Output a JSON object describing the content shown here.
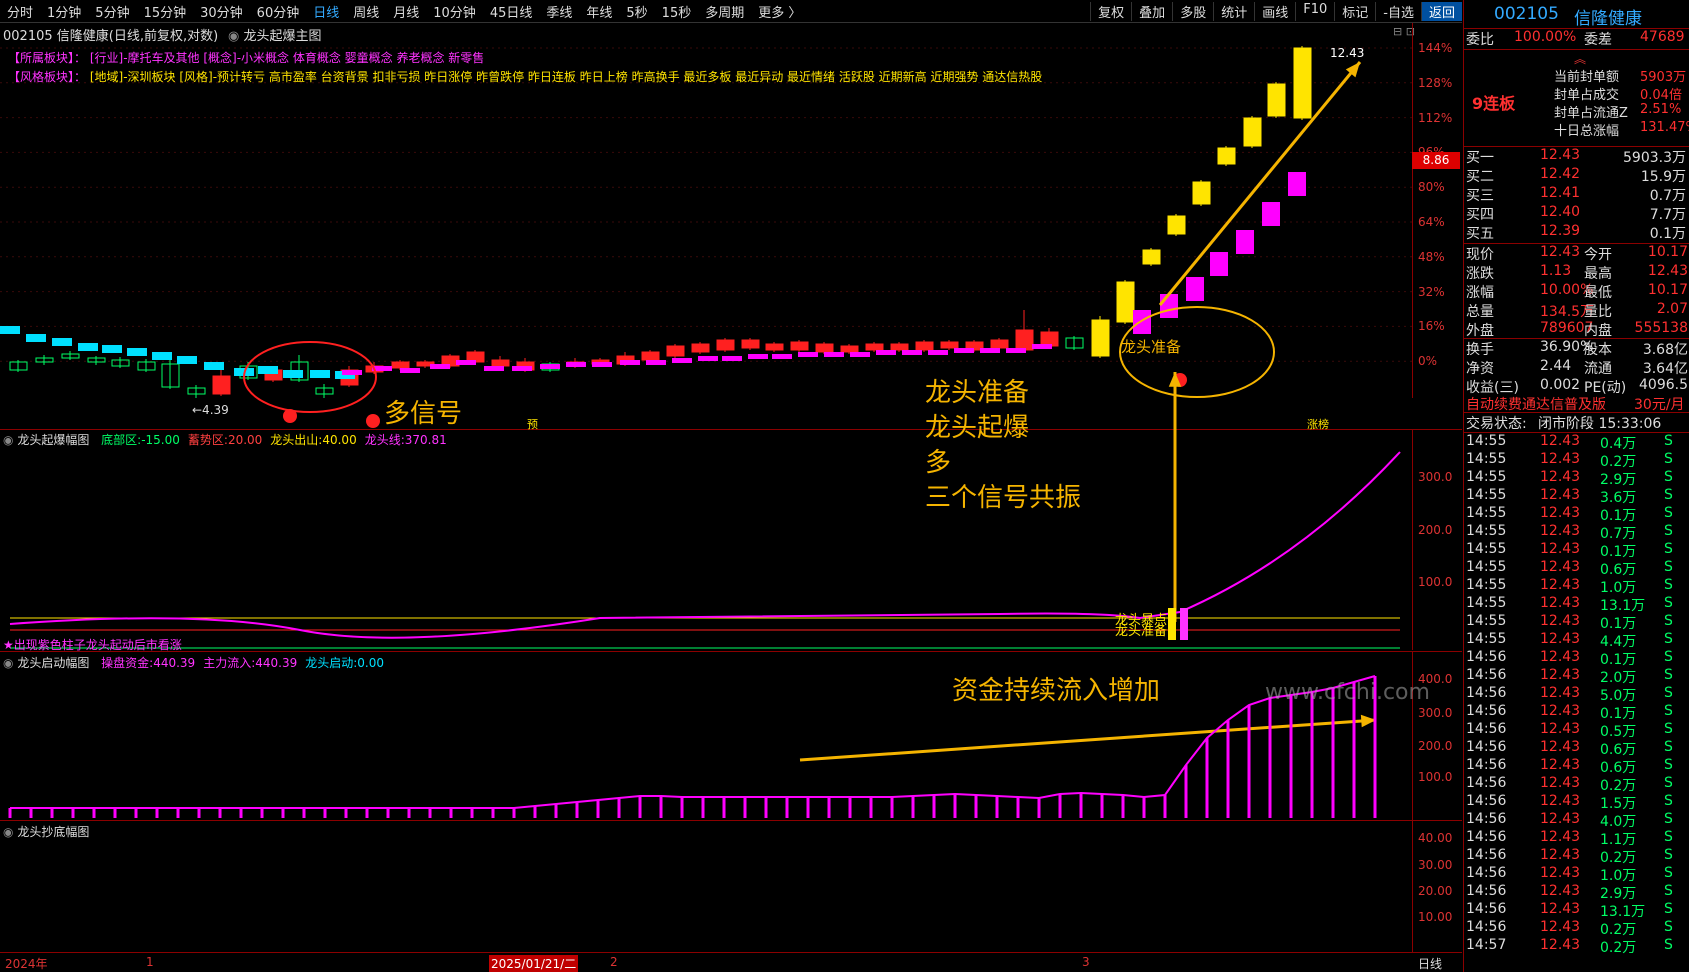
{
  "colors": {
    "up": "#ff2020",
    "down": "#00ff66",
    "magenta": "#ff00ff",
    "yellow": "#ffe400",
    "cyan": "#00e0ff",
    "accent": "#f5b400"
  },
  "toolbar": {
    "left": [
      "分时",
      "1分钟",
      "5分钟",
      "15分钟",
      "30分钟",
      "60分钟",
      "日线",
      "周线",
      "月线",
      "10分钟",
      "45日线",
      "季线",
      "年线",
      "5秒",
      "15秒",
      "多周期",
      "更多 〉"
    ],
    "active": "日线",
    "right": [
      "复权",
      "叠加",
      "多股",
      "统计",
      "画线",
      "F10",
      "标记",
      "-自选",
      "返回"
    ]
  },
  "chart": {
    "title": "002105 信隆健康(日线,前复权,对数)",
    "subtitle": "龙头起爆主图",
    "sector_label": "【所属板块】：",
    "sector_text": "[行业]-摩托车及其他 [概念]-小米概念 体育概念 婴童概念 养老概念 新零售",
    "style_label": "【风格板块】：",
    "style_text": "[地域]-深圳板块 [风格]-预计转亏 高市盈率 台资背景 扣非亏损 昨日涨停 昨曾跌停 昨日连板 昨日上榜 昨高换手 最近多板 最近异动 最近情绪 活跃股 近期新高 近期强势 通达信热股",
    "yaxis": [
      "144%",
      "128%",
      "112%",
      "96%",
      "80%",
      "64%",
      "48%",
      "32%",
      "16%",
      "0%"
    ],
    "price_tag": "8.86",
    "high_label": "12.43",
    "low_label": "←4.39",
    "marker_yu": "预",
    "marker_zb": "涨榜",
    "signal_circle_text": "龙头准备",
    "duo": "多"
  },
  "annotations": {
    "duo_signal": "多信号",
    "lines": [
      "龙头准备",
      "龙头起爆",
      "多",
      "三个信号共振"
    ],
    "fund": "资金持续流入增加",
    "watermark": "www.cfchi.com"
  },
  "panel1": {
    "title": "龙头起爆幅图",
    "items": [
      {
        "label": "底部区:",
        "value": "-15.00"
      },
      {
        "label": "蓄势区:",
        "value": "20.00"
      },
      {
        "label": "龙头出山:",
        "value": "40.00"
      },
      {
        "label": "龙头线:",
        "value": "370.81"
      }
    ],
    "yaxis": [
      "300.0",
      "200.0",
      "100.0"
    ],
    "note": "★出现紫色柱子龙头起动后市看涨",
    "tag1": "龙头暴点",
    "tag2": "龙头准备"
  },
  "panel2": {
    "title": "龙头启动幅图",
    "items": [
      {
        "label": "操盘资金:",
        "value": "440.39"
      },
      {
        "label": "主力流入:",
        "value": "440.39"
      },
      {
        "label": "龙头启动:",
        "value": "0.00"
      }
    ],
    "yaxis": [
      "400.0",
      "300.0",
      "200.0",
      "100.0"
    ]
  },
  "panel3": {
    "title": "龙头抄底幅图",
    "yaxis": [
      "40.00",
      "30.00",
      "20.00",
      "10.00"
    ]
  },
  "timeaxis": {
    "labels": [
      "2024年",
      "1",
      "2025/01/21/二",
      "2",
      "3"
    ],
    "period": "日线"
  },
  "quote": {
    "code": "002105",
    "name": "信隆健康",
    "weibi_label": "委比",
    "weibi": "100.00%",
    "weicha_label": "委差",
    "weicha": "47689",
    "board": "9连板",
    "seal_items": [
      {
        "label": "当前封单额",
        "value": "5903万"
      },
      {
        "label": "封单占成交",
        "value": "0.04倍"
      },
      {
        "label": "封单占流通Z",
        "value": "2.51%"
      },
      {
        "label": "十日总涨幅",
        "value": "131.47%"
      }
    ],
    "bids": [
      {
        "label": "买一",
        "price": "12.43",
        "vol": "5903.3万"
      },
      {
        "label": "买二",
        "price": "12.42",
        "vol": "15.9万"
      },
      {
        "label": "买三",
        "price": "12.41",
        "vol": "0.7万"
      },
      {
        "label": "买四",
        "price": "12.40",
        "vol": "7.7万"
      },
      {
        "label": "买五",
        "price": "12.39",
        "vol": "0.1万"
      }
    ],
    "stats": [
      {
        "l1": "现价",
        "v1": "12.43",
        "l2": "今开",
        "v2": "10.17"
      },
      {
        "l1": "涨跌",
        "v1": "1.13",
        "l2": "最高",
        "v2": "12.43"
      },
      {
        "l1": "涨幅",
        "v1": "10.00%",
        "l2": "最低",
        "v2": "10.17"
      },
      {
        "l1": "总量",
        "v1": "134.5万",
        "l2": "量比",
        "v2": "2.07"
      },
      {
        "l1": "外盘",
        "v1": "789607",
        "l2": "内盘",
        "v2": "555138"
      }
    ],
    "stats2": [
      {
        "l1": "换手",
        "v1": "36.90%",
        "l2": "股本",
        "v2": "3.68亿"
      },
      {
        "l1": "净资",
        "v1": "2.44",
        "l2": "流通",
        "v2": "3.64亿"
      },
      {
        "l1": "收益(三)",
        "v1": "0.002",
        "l2": "PE(动)",
        "v2": "4096.5"
      }
    ],
    "banner": "自动续费通达信普及版",
    "price_tag": "30元/月",
    "status_label": "交易状态:",
    "status": "闭市阶段 15:33:06",
    "ticks": [
      [
        "14:55",
        "12.43",
        "0.4万",
        "S"
      ],
      [
        "14:55",
        "12.43",
        "0.2万",
        "S"
      ],
      [
        "14:55",
        "12.43",
        "2.9万",
        "S"
      ],
      [
        "14:55",
        "12.43",
        "3.6万",
        "S"
      ],
      [
        "14:55",
        "12.43",
        "0.1万",
        "S"
      ],
      [
        "14:55",
        "12.43",
        "0.7万",
        "S"
      ],
      [
        "14:55",
        "12.43",
        "0.1万",
        "S"
      ],
      [
        "14:55",
        "12.43",
        "0.6万",
        "S"
      ],
      [
        "14:55",
        "12.43",
        "1.0万",
        "S"
      ],
      [
        "14:55",
        "12.43",
        "13.1万",
        "S"
      ],
      [
        "14:55",
        "12.43",
        "0.1万",
        "S"
      ],
      [
        "14:55",
        "12.43",
        "4.4万",
        "S"
      ],
      [
        "14:56",
        "12.43",
        "0.1万",
        "S"
      ],
      [
        "14:56",
        "12.43",
        "2.0万",
        "S"
      ],
      [
        "14:56",
        "12.43",
        "5.0万",
        "S"
      ],
      [
        "14:56",
        "12.43",
        "0.1万",
        "S"
      ],
      [
        "14:56",
        "12.43",
        "0.5万",
        "S"
      ],
      [
        "14:56",
        "12.43",
        "0.6万",
        "S"
      ],
      [
        "14:56",
        "12.43",
        "0.6万",
        "S"
      ],
      [
        "14:56",
        "12.43",
        "0.2万",
        "S"
      ],
      [
        "14:56",
        "12.43",
        "1.5万",
        "S"
      ],
      [
        "14:56",
        "12.43",
        "4.0万",
        "S"
      ],
      [
        "14:56",
        "12.43",
        "1.1万",
        "S"
      ],
      [
        "14:56",
        "12.43",
        "0.2万",
        "S"
      ],
      [
        "14:56",
        "12.43",
        "1.0万",
        "S"
      ],
      [
        "14:56",
        "12.43",
        "2.9万",
        "S"
      ],
      [
        "14:56",
        "12.43",
        "13.1万",
        "S"
      ],
      [
        "14:56",
        "12.43",
        "0.2万",
        "S"
      ],
      [
        "14:57",
        "12.43",
        "0.2万",
        "S"
      ]
    ]
  }
}
